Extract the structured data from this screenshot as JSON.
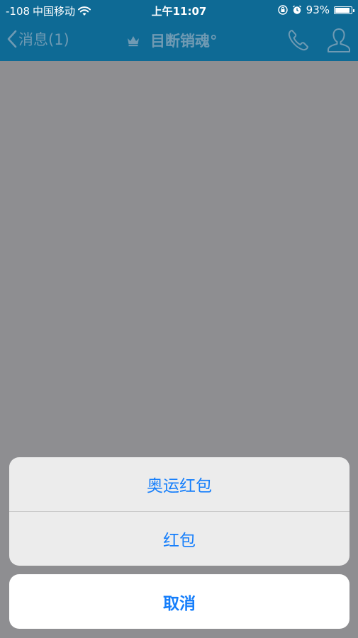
{
  "status_bar": {
    "signal": "-108",
    "carrier": "中国移动",
    "wifi_icon": "wifi-icon",
    "time": "上午11:07",
    "lock_icon": "rotation-lock-icon",
    "alarm_icon": "alarm-icon",
    "battery_percent": "93%",
    "battery_level": 0.93
  },
  "nav": {
    "back_label": "消息(1)",
    "crown_icon": "crown-icon",
    "title": "目断销魂°",
    "phone_icon": "phone-icon",
    "profile_icon": "profile-icon"
  },
  "action_sheet": {
    "items": [
      {
        "label": "奥运红包"
      },
      {
        "label": "红包"
      }
    ],
    "cancel_label": "取消"
  },
  "colors": {
    "nav_bg": "#0e6a95",
    "overlay": "#8e8e91",
    "action_text": "#157efb"
  }
}
